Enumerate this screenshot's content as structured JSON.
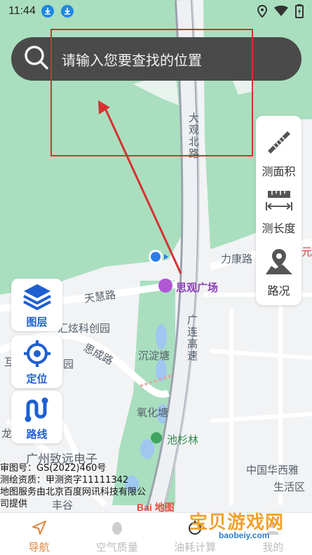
{
  "status_bar": {
    "time": "11:44",
    "icons": [
      "download-icon",
      "download-icon",
      "location-icon",
      "wifi-icon",
      "battery-icon"
    ]
  },
  "search": {
    "placeholder": "请输入您要查找的位置",
    "icon": "search-icon"
  },
  "right_tools": [
    {
      "label": "测面积",
      "icon": "ruler-area-icon"
    },
    {
      "label": "测长度",
      "icon": "measure-length-icon"
    },
    {
      "label": "路况",
      "icon": "map-traffic-icon"
    }
  ],
  "left_controls": [
    {
      "label": "图层",
      "icon": "layers-icon"
    },
    {
      "label": "定位",
      "icon": "locate-icon"
    },
    {
      "label": "路线",
      "icon": "route-icon"
    }
  ],
  "map_labels": {
    "road_north": "大观北路",
    "road_likang": "力康路",
    "road_tianhui": "天慧路",
    "square": "思观广场",
    "park": "汇炫科创园",
    "road_chengcheng": "思成路",
    "park2": "园",
    "pond1": "沉淀塘",
    "expressway": "广连高速",
    "pond2": "氧化塘",
    "forest": "池杉林",
    "company": "广州致远电子",
    "company2": "中国华西雅",
    "district": "生活区",
    "area_bottom": "丰谷",
    "edge_right": "元",
    "edge_left": "龙",
    "edge_left2": "互",
    "baidu_logo": "Bai 地图"
  },
  "map_info": {
    "line1": "审图号：GS(2022)460号",
    "line2": "测绘资质：甲测资字11111342",
    "line3": "地图服务由北京百度网讯科技有限公",
    "line4": "司提供"
  },
  "bottom_nav": [
    {
      "label": "导航",
      "icon": "navigation-arrow-icon",
      "active": true
    },
    {
      "label": "空气质量",
      "icon": "air-drop-icon",
      "active": false
    },
    {
      "label": "油耗计算",
      "icon": "fuel-icon",
      "active": false
    },
    {
      "label": "我的",
      "icon": "profile-icon",
      "active": false
    }
  ],
  "watermark": {
    "text": "宝贝游戏网",
    "sub": "baobeiy.com"
  },
  "colors": {
    "map_green": "#a9dfbf",
    "search_bg": "#4a4a4a",
    "accent_blue": "#1f5fd1",
    "nav_active": "#e2833a",
    "annotation_red": "#d63131"
  }
}
